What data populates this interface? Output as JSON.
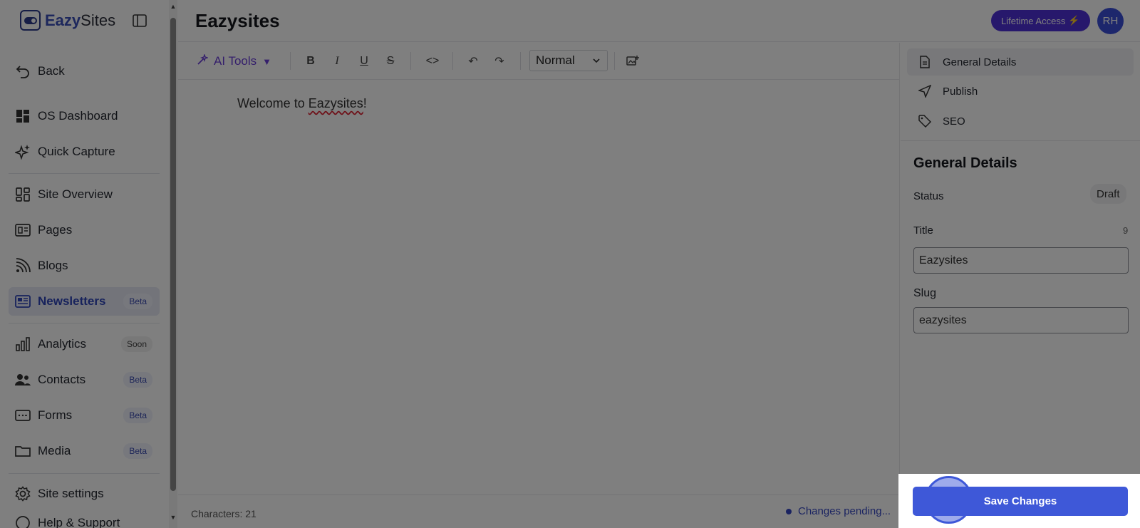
{
  "app": {
    "brand_bold": "Eazy",
    "brand_rest": "Sites"
  },
  "sidebar": {
    "items": [
      {
        "label": "Back"
      },
      {
        "label": "OS Dashboard"
      },
      {
        "label": "Quick Capture"
      },
      {
        "label": "Site Overview"
      },
      {
        "label": "Pages"
      },
      {
        "label": "Blogs"
      },
      {
        "label": "Newsletters",
        "badge": "Beta",
        "active": true
      },
      {
        "label": "Analytics",
        "badge": "Soon"
      },
      {
        "label": "Contacts",
        "badge": "Beta"
      },
      {
        "label": "Forms",
        "badge": "Beta"
      },
      {
        "label": "Media",
        "badge": "Beta"
      },
      {
        "label": "Site settings"
      },
      {
        "label": "Help & Support"
      }
    ]
  },
  "header": {
    "title": "Eazysites",
    "lifetime_label": "Lifetime Access",
    "lifetime_icon": "⚡",
    "avatar_initials": "RH"
  },
  "toolbar": {
    "ai_tools_label": "AI Tools",
    "ai_tools_caret": "▼",
    "format_value": "Normal"
  },
  "editor": {
    "content_prefix": "Welcome to ",
    "content_misspelled": "Eazysites",
    "content_suffix": "!",
    "characters": "Characters: 21",
    "status": "Changes pending..."
  },
  "panel": {
    "tabs": [
      {
        "label": "General Details",
        "active": true
      },
      {
        "label": "Publish"
      },
      {
        "label": "SEO"
      }
    ],
    "section_title": "General Details",
    "status_label": "Status",
    "status_value": "Draft",
    "title_label": "Title",
    "title_count": "9",
    "title_value": "Eazysites",
    "slug_label": "Slug",
    "slug_value": "eazysites"
  },
  "actions": {
    "save_label": "Save Changes"
  },
  "colors": {
    "accent": "#3e58d8",
    "brand": "#3a4fb8",
    "lifetime": "#4f31d8"
  }
}
